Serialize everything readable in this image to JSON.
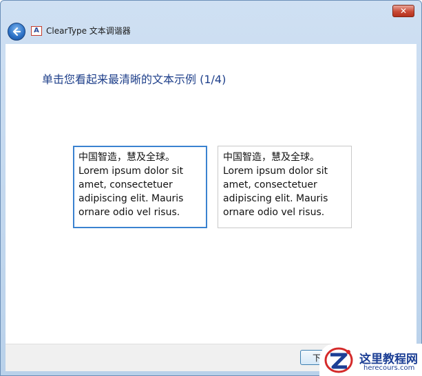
{
  "window": {
    "close_label": "✕"
  },
  "header": {
    "app_icon_glyph": "A",
    "title": "ClearType 文本调谐器"
  },
  "main": {
    "heading": "单击您看起来最清晰的文本示例 (1/4)",
    "samples": [
      {
        "lines": [
          "中国智造，慧及全球。",
          "Lorem ipsum dolor sit",
          "amet, consectetuer",
          "adipiscing elit. Mauris",
          "ornare odio vel risus."
        ],
        "selected": true
      },
      {
        "lines": [
          "中国智造，慧及全球。",
          "Lorem ipsum dolor sit",
          "amet, consectetuer",
          "adipiscing elit. Mauris",
          "ornare odio vel risus."
        ],
        "selected": false
      }
    ]
  },
  "footer": {
    "next_label": "下一步"
  },
  "watermark": {
    "title": "这里教程网",
    "subtitle": "herecours.com"
  },
  "colors": {
    "heading": "#1e3f8a",
    "selection_border": "#3a82d0",
    "close_button": "#c94a36"
  }
}
